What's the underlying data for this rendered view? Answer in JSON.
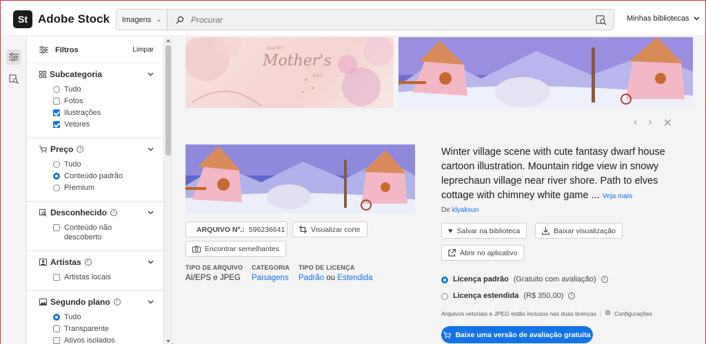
{
  "header": {
    "logo": "St",
    "brand": "Adobe Stock",
    "asset_type": "Imagens",
    "search_placeholder": "Procurar",
    "libraries": "Minhas bibliotecas"
  },
  "filters": {
    "title": "Filtros",
    "clear": "Limpar",
    "sections": [
      {
        "title": "Subcategoria",
        "options": [
          {
            "label": "Tudo",
            "kind": "radio",
            "on": false
          },
          {
            "label": "Fotos",
            "kind": "check",
            "on": false
          },
          {
            "label": "Ilustrações",
            "kind": "check",
            "on": true
          },
          {
            "label": "Vetores",
            "kind": "check",
            "on": true
          }
        ]
      },
      {
        "title": "Preço",
        "options": [
          {
            "label": "Tudo",
            "kind": "radio",
            "on": false
          },
          {
            "label": "Conteúdo padrão",
            "kind": "radio",
            "on": true
          },
          {
            "label": "Premium",
            "kind": "radio",
            "on": false
          }
        ]
      },
      {
        "title": "Desconhecido",
        "options": [
          {
            "label": "Conteúdo não descoberto",
            "kind": "check",
            "on": false
          }
        ]
      },
      {
        "title": "Artistas",
        "options": [
          {
            "label": "Artistas locais",
            "kind": "check",
            "on": false
          }
        ]
      },
      {
        "title": "Segundo plano",
        "options": [
          {
            "label": "Tudo",
            "kind": "radio",
            "on": true
          },
          {
            "label": "Transparente",
            "kind": "check",
            "on": false
          },
          {
            "label": "Ativos isolados",
            "kind": "check",
            "on": false
          }
        ]
      }
    ]
  },
  "thumbs": {
    "mothers_day_line1": "HAPPY",
    "mothers_day_line2": "Mother's",
    "mothers_day_line3": "DAY"
  },
  "detail": {
    "file_label": "ARQUIVO Nº.:",
    "file_number": "596236641",
    "view_crop": "Visualizar corte",
    "find_similar": "Encontrar semelhantes",
    "meta": [
      {
        "head": "TIPO DE ARQUIVO",
        "value": "AI/EPS e JPEG"
      },
      {
        "head": "CATEGORIA",
        "value": "Paisagens"
      },
      {
        "head": "TIPO DE LICENÇA",
        "value_a": "Padrão",
        "value_mid": " ou ",
        "value_b": "Estendida"
      }
    ],
    "title": "Winter village scene with cute fantasy dwarf house cartoon illustration. Mountain ridge view in snowy leprechaun village near river shore. Path to elves cottage with chimney white game ...",
    "see_more": "Veja mais",
    "author_prefix": "De",
    "author": "klyaksun",
    "save_library": "Salvar na biblioteca",
    "download_preview": "Baixar visualização",
    "open_app": "Abrir no aplicativo",
    "license_standard": "Licença padrão",
    "license_standard_sub": "(Gratuito com avaliação)",
    "license_extended": "Licença estendida",
    "license_extended_sub": "(R$ 350,00)",
    "note": "Arquivos vetoriais e JPEG estão inclusos nas duas licenças",
    "settings": "Configurações",
    "cta": "Baixe uma versão de avaliação gratuita"
  },
  "colors": {
    "accent": "#1473e6"
  }
}
